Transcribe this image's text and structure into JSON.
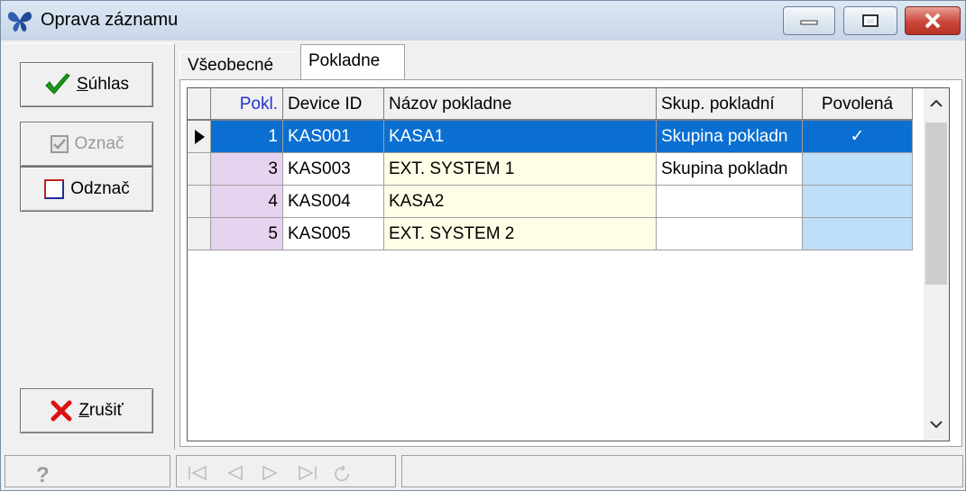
{
  "window": {
    "title": "Oprava záznamu"
  },
  "left_buttons": {
    "suhlas": {
      "first": "S",
      "rest": "úhlas"
    },
    "oznac": {
      "label": "Označ"
    },
    "odznac": {
      "label": "Odznač"
    },
    "zrusit": {
      "first": "Z",
      "rest": "rušiť"
    }
  },
  "tabs": [
    {
      "label": "Všeobecné",
      "active": false
    },
    {
      "label": "Pokladne",
      "active": true
    }
  ],
  "grid": {
    "columns": [
      "Pokl.",
      "Device ID",
      "Názov pokladne",
      "Skup. pokladní",
      "Povolená"
    ],
    "rows": [
      {
        "pokl": "1",
        "device_id": "KAS001",
        "nazov": "KASA1",
        "skupina": "Skupina pokladn",
        "povolena": "✓",
        "selected": true
      },
      {
        "pokl": "3",
        "device_id": "KAS003",
        "nazov": "EXT. SYSTEM 1",
        "skupina": "Skupina pokladn",
        "povolena": "",
        "selected": false
      },
      {
        "pokl": "4",
        "device_id": "KAS004",
        "nazov": "KASA2",
        "skupina": "",
        "povolena": "",
        "selected": false
      },
      {
        "pokl": "5",
        "device_id": "KAS005",
        "nazov": "EXT. SYSTEM 2",
        "skupina": "",
        "povolena": "",
        "selected": false
      }
    ]
  },
  "statusbar": {
    "help_icon": "?"
  },
  "icons": {
    "navigator": [
      "first-record-icon",
      "prior-record-icon",
      "next-record-icon",
      "last-record-icon",
      "refresh-icon"
    ]
  },
  "colors": {
    "selection": "#0a6fd1",
    "pokl_column": "#e6d3ef",
    "name_column": "#fefde6",
    "povolena_column": "#bfdff9"
  }
}
